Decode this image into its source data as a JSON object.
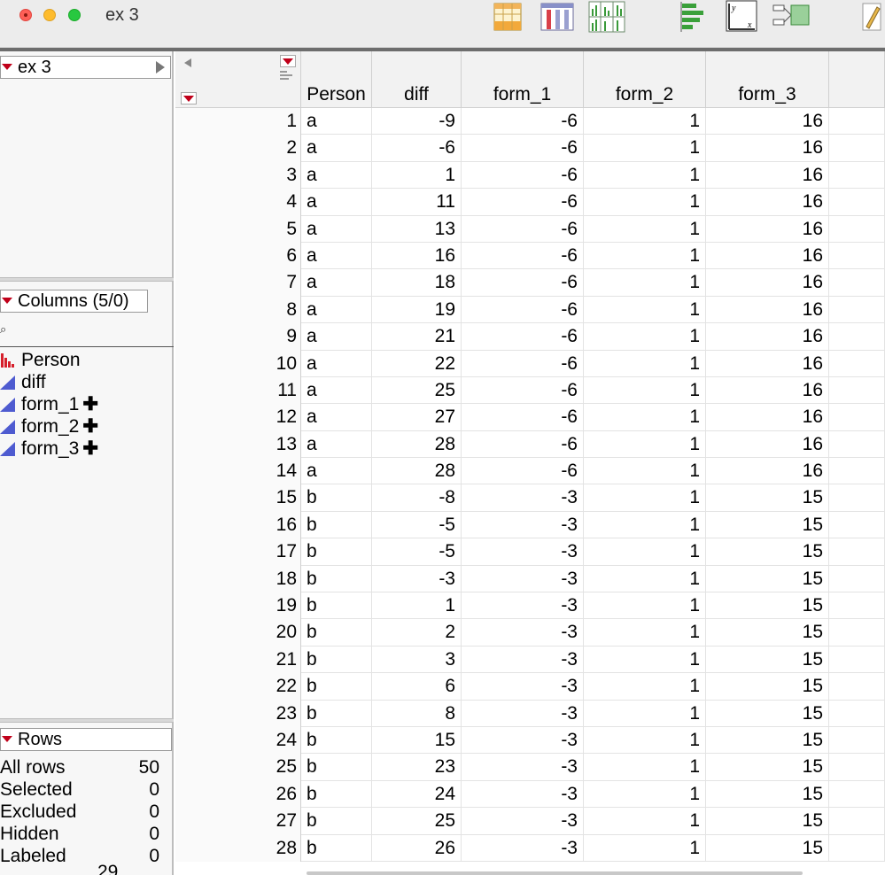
{
  "window": {
    "title": "ex 3"
  },
  "toolbar": {
    "icons": [
      "data-table-icon",
      "columns-icon",
      "distribution-grid-icon",
      "bar-chart-icon",
      "fit-y-by-x-icon",
      "fit-model-icon",
      "edit-icon"
    ]
  },
  "left_panel": {
    "dataset_name": "ex 3",
    "columns_header": "Columns (5/0)",
    "columns": [
      {
        "name": "Person",
        "type": "nominal",
        "formula": ""
      },
      {
        "name": "diff",
        "type": "continuous",
        "formula": ""
      },
      {
        "name": "form_1",
        "type": "continuous",
        "formula": "✚"
      },
      {
        "name": "form_2",
        "type": "continuous",
        "formula": "✚"
      },
      {
        "name": "form_3",
        "type": "continuous",
        "formula": "✚"
      }
    ],
    "rows_header": "Rows",
    "row_stats": [
      {
        "label": "All rows",
        "value": "50"
      },
      {
        "label": "Selected",
        "value": "0"
      },
      {
        "label": "Excluded",
        "value": "0"
      },
      {
        "label": "Hidden",
        "value": "0"
      },
      {
        "label": "Labeled",
        "value": "0"
      }
    ]
  },
  "table": {
    "headers": [
      "Person",
      "diff",
      "form_1",
      "form_2",
      "form_3"
    ],
    "rows": [
      [
        "1",
        "a",
        "-9",
        "-6",
        "1",
        "16"
      ],
      [
        "2",
        "a",
        "-6",
        "-6",
        "1",
        "16"
      ],
      [
        "3",
        "a",
        "1",
        "-6",
        "1",
        "16"
      ],
      [
        "4",
        "a",
        "11",
        "-6",
        "1",
        "16"
      ],
      [
        "5",
        "a",
        "13",
        "-6",
        "1",
        "16"
      ],
      [
        "6",
        "a",
        "16",
        "-6",
        "1",
        "16"
      ],
      [
        "7",
        "a",
        "18",
        "-6",
        "1",
        "16"
      ],
      [
        "8",
        "a",
        "19",
        "-6",
        "1",
        "16"
      ],
      [
        "9",
        "a",
        "21",
        "-6",
        "1",
        "16"
      ],
      [
        "10",
        "a",
        "22",
        "-6",
        "1",
        "16"
      ],
      [
        "11",
        "a",
        "25",
        "-6",
        "1",
        "16"
      ],
      [
        "12",
        "a",
        "27",
        "-6",
        "1",
        "16"
      ],
      [
        "13",
        "a",
        "28",
        "-6",
        "1",
        "16"
      ],
      [
        "14",
        "a",
        "28",
        "-6",
        "1",
        "16"
      ],
      [
        "15",
        "b",
        "-8",
        "-3",
        "1",
        "15"
      ],
      [
        "16",
        "b",
        "-5",
        "-3",
        "1",
        "15"
      ],
      [
        "17",
        "b",
        "-5",
        "-3",
        "1",
        "15"
      ],
      [
        "18",
        "b",
        "-3",
        "-3",
        "1",
        "15"
      ],
      [
        "19",
        "b",
        "1",
        "-3",
        "1",
        "15"
      ],
      [
        "20",
        "b",
        "2",
        "-3",
        "1",
        "15"
      ],
      [
        "21",
        "b",
        "3",
        "-3",
        "1",
        "15"
      ],
      [
        "22",
        "b",
        "6",
        "-3",
        "1",
        "15"
      ],
      [
        "23",
        "b",
        "8",
        "-3",
        "1",
        "15"
      ],
      [
        "24",
        "b",
        "15",
        "-3",
        "1",
        "15"
      ],
      [
        "25",
        "b",
        "23",
        "-3",
        "1",
        "15"
      ],
      [
        "26",
        "b",
        "24",
        "-3",
        "1",
        "15"
      ],
      [
        "27",
        "b",
        "25",
        "-3",
        "1",
        "15"
      ],
      [
        "28",
        "b",
        "26",
        "-3",
        "1",
        "15"
      ]
    ],
    "partial_row_number": "29"
  },
  "colors": {
    "menu_triangle": "#c0001a",
    "continuous_icon": "#4e5bd0",
    "nominal_icon": "#d6202c"
  }
}
